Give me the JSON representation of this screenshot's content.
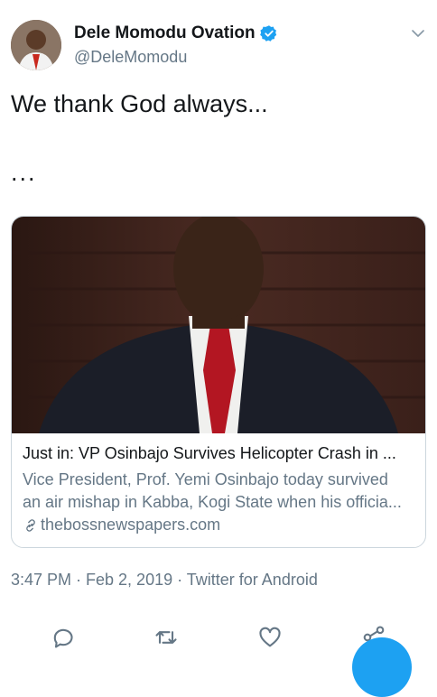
{
  "tweet": {
    "display_name": "Dele Momodu Ovation",
    "handle": "@DeleMomodu",
    "text": "We thank God always...",
    "text_line2": "...",
    "timestamp": "3:47 PM · Feb 2, 2019 · Twitter for Android"
  },
  "card": {
    "title": "Just in: VP Osinbajo Survives Helicopter Crash in ...",
    "desc_line1": "Vice President, Prof. Yemi Osinbajo today survived",
    "desc_line2": "an air mishap in Kabba, Kogi State when his officia...",
    "domain": "thebossnewspapers.com"
  },
  "icons": {
    "verified": "verified-badge-icon",
    "chevron": "chevron-down-icon",
    "link": "link-icon",
    "reply": "reply-icon",
    "retweet": "retweet-icon",
    "like": "heart-icon",
    "share": "share-icon"
  },
  "colors": {
    "accent": "#1da1f2",
    "secondary_text": "#657786",
    "primary_text": "#14171a",
    "border": "#ccd6dd"
  }
}
